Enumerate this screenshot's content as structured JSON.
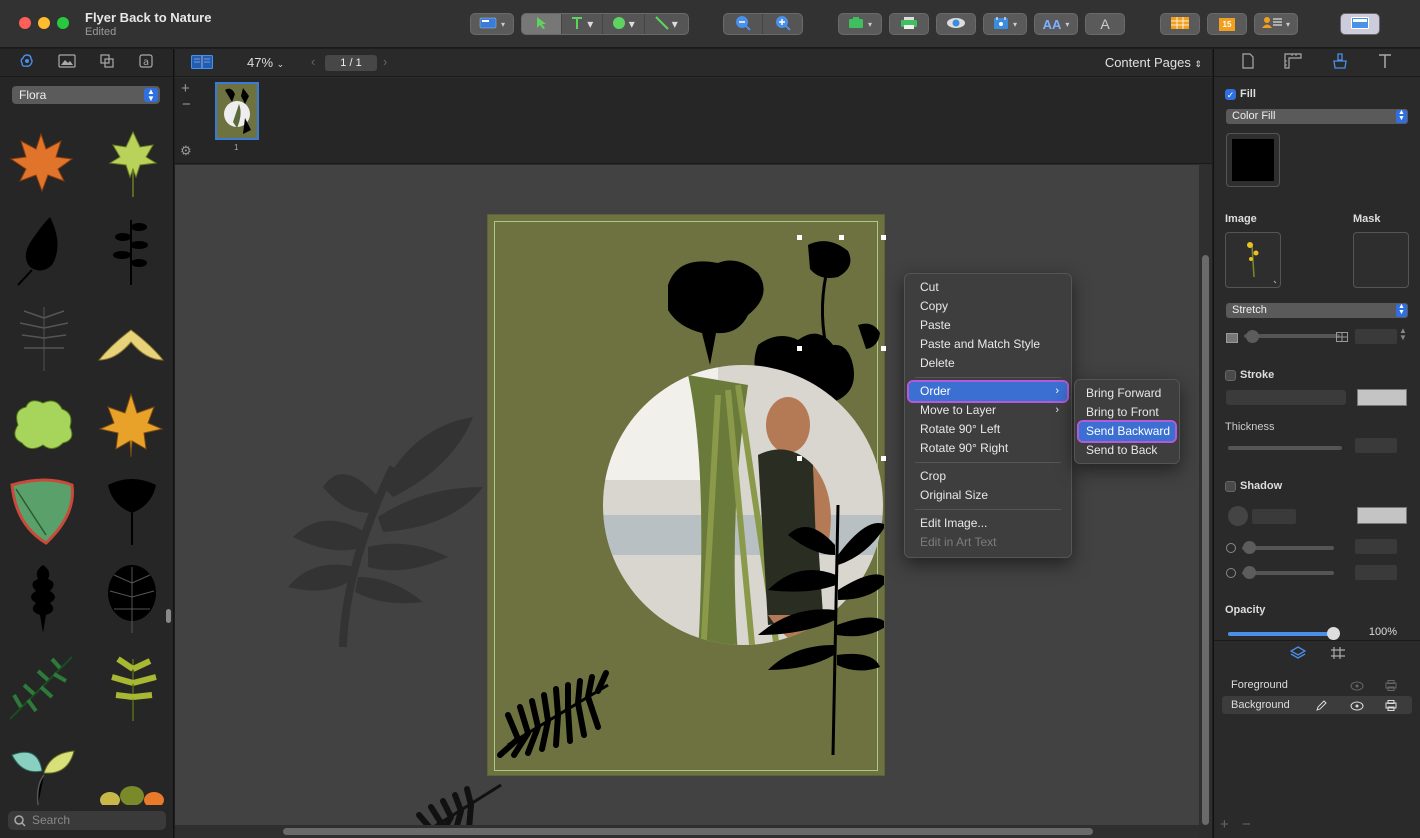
{
  "window": {
    "title": "Flyer Back to Nature",
    "subtitle": "Edited"
  },
  "toolbar": {
    "icons": [
      "layout-icon",
      "pointer-icon",
      "text-tool-icon",
      "shape-tool-icon",
      "line-tool-icon",
      "zoom-out-icon",
      "zoom-in-icon",
      "image-tool-icon",
      "print-icon",
      "preview-icon",
      "photo-icon",
      "font-icon",
      "text-style-icon",
      "table-icon",
      "calendar-icon",
      "contacts-icon",
      "sidebar-toggle-icon"
    ],
    "calendar_badge": "15",
    "accent": "#f0a01e"
  },
  "left_panel": {
    "library_select": "Flora",
    "search_placeholder": "Search",
    "tabs": [
      "clipart-icon",
      "image-icon",
      "shapes-icon",
      "text-icon"
    ]
  },
  "center_bar": {
    "zoom": "47%",
    "page_indicator": "1 / 1",
    "view_mode": "Content Pages"
  },
  "thumbnails": [
    {
      "number": "1"
    }
  ],
  "context_menu": {
    "items": [
      {
        "label": "Cut",
        "enabled": true
      },
      {
        "label": "Copy",
        "enabled": true
      },
      {
        "label": "Paste",
        "enabled": true
      },
      {
        "label": "Paste and Match Style",
        "enabled": true
      },
      {
        "label": "Delete",
        "enabled": true
      },
      {
        "label": "Order",
        "enabled": true,
        "submenu": true,
        "highlighted": true
      },
      {
        "label": "Move to Layer",
        "enabled": true,
        "submenu": true
      },
      {
        "label": "Rotate 90° Left",
        "enabled": true
      },
      {
        "label": "Rotate 90° Right",
        "enabled": true
      },
      {
        "label": "Crop",
        "enabled": true
      },
      {
        "label": "Original Size",
        "enabled": true
      },
      {
        "label": "Edit Image...",
        "enabled": true
      },
      {
        "label": "Edit in Art Text",
        "enabled": false
      }
    ]
  },
  "order_submenu": {
    "items": [
      {
        "label": "Bring Forward"
      },
      {
        "label": "Bring to Front"
      },
      {
        "label": "Send Backward",
        "highlighted": true
      },
      {
        "label": "Send to Back"
      }
    ]
  },
  "inspector": {
    "tabs": [
      "document-icon",
      "ruler-icon",
      "fill-brush-icon",
      "text-icon"
    ],
    "fill": {
      "label": "Fill",
      "checked": true,
      "type": "Color Fill",
      "color": "#000000"
    },
    "image_label": "Image",
    "mask_label": "Mask",
    "image_mode": "Stretch",
    "stroke": {
      "label": "Stroke",
      "checked": false
    },
    "thickness_label": "Thickness",
    "shadow": {
      "label": "Shadow",
      "checked": false
    },
    "opacity": {
      "label": "Opacity",
      "value": "100%",
      "level": 1.0
    }
  },
  "layers": {
    "tabs": [
      "layers-icon",
      "grid-icon"
    ],
    "rows": [
      {
        "name": "Foreground",
        "selected": false
      },
      {
        "name": "Background",
        "selected": true
      }
    ]
  },
  "colors": {
    "page_background": "#6d7240",
    "selection_blue": "#3b6fd1",
    "highlight_outline": "#b35ad8"
  }
}
